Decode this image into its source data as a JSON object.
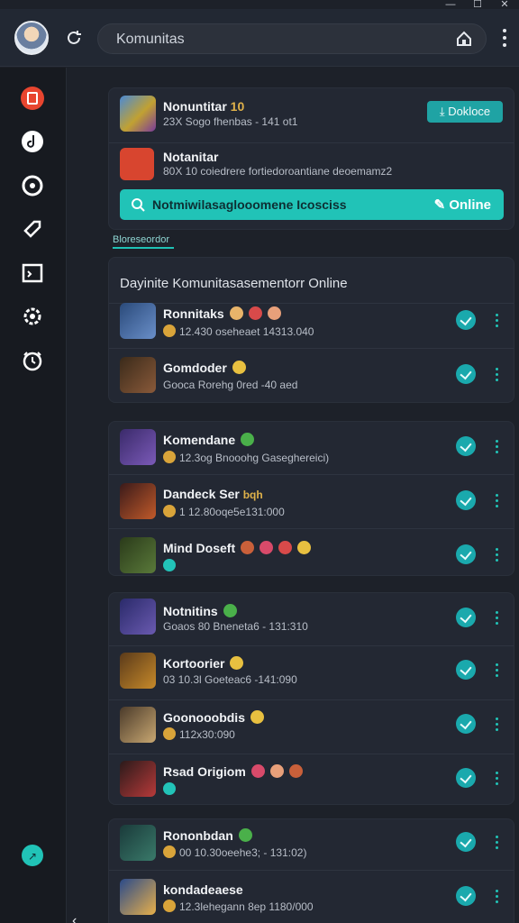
{
  "window": {
    "minimize": "—",
    "maximize": "☐",
    "close": "✕"
  },
  "topbar": {
    "search_value": "Komunitas",
    "refresh_icon": "refresh-icon",
    "home_icon": "home-icon"
  },
  "sidebar": {
    "items": [
      {
        "icon": "bookmark-icon",
        "color": "#e8452f"
      },
      {
        "icon": "music-icon",
        "color": "#ffffff"
      },
      {
        "icon": "cycle-icon",
        "color": "#ffffff"
      },
      {
        "icon": "tag-icon",
        "color": "#ffffff"
      },
      {
        "icon": "image-icon",
        "color": "#ffffff"
      },
      {
        "icon": "gear-icon",
        "color": "#ffffff"
      },
      {
        "icon": "timer-icon",
        "color": "#ffffff"
      }
    ],
    "profile_badge": "↗",
    "collapse": "‹"
  },
  "header_card": {
    "row1": {
      "title": "Nonuntitar",
      "title_num": "10",
      "sub": "23X Sogo fhenbas - 141 ot1",
      "button": "Dokloce"
    },
    "row2": {
      "title": "Notanitar",
      "sub": "80X 10 coiedrere fortiedoroantiane deoemamz2"
    },
    "bar": {
      "text": "Notmiwilasaglooomene Icosciss",
      "right": "Online"
    }
  },
  "tab": {
    "label": "Bloreseordor"
  },
  "section": {
    "title": "Dayinite Komunitasasementorr Online",
    "groups": [
      {
        "rows": [
          {
            "title": "Ronnitaks",
            "sub": "12.430 oseheaet 14313.040",
            "accent": "#6a8fc9"
          },
          {
            "title": "Gomdoder",
            "sub": "Gooca Rorehg 0red -40 aed",
            "accent": "#8a5a3a"
          }
        ]
      },
      {
        "rows": [
          {
            "title": "Komendane",
            "sub": "12.3og Bnooohg Gaseghereici)",
            "accent": "#7b5ab8"
          },
          {
            "title": "Dandeck Ser",
            "title_extra": "bqh",
            "sub": "1 12.80oqe5e131:000",
            "accent": "#c15a2a"
          },
          {
            "title": "Mind Doseft",
            "sub": "",
            "accent": "#5a7a3a"
          }
        ]
      },
      {
        "rows": [
          {
            "title": "Notnitins",
            "sub": "Goaos 80 Bneneta6 - 131:310",
            "accent": "#6a5ab0"
          },
          {
            "title": "Kortoorier",
            "sub": "03 10.3l Goeteac6 -141:090",
            "accent": "#c78a2a"
          },
          {
            "title": "Goonooobdis",
            "sub": "112x30:090",
            "accent": "#c9a872"
          },
          {
            "title": "Rsad Origiom",
            "sub": "",
            "accent": "#b83a3a"
          }
        ]
      },
      {
        "rows": [
          {
            "title": "Rononbdan",
            "sub": "00 10.30oeehe3; - 131:02)",
            "accent": "#3a7a6a"
          },
          {
            "title": "kondadeaese",
            "sub": "12.3lehegann 8ep 1180/000",
            "accent": "#3a6ab8"
          }
        ]
      }
    ]
  }
}
